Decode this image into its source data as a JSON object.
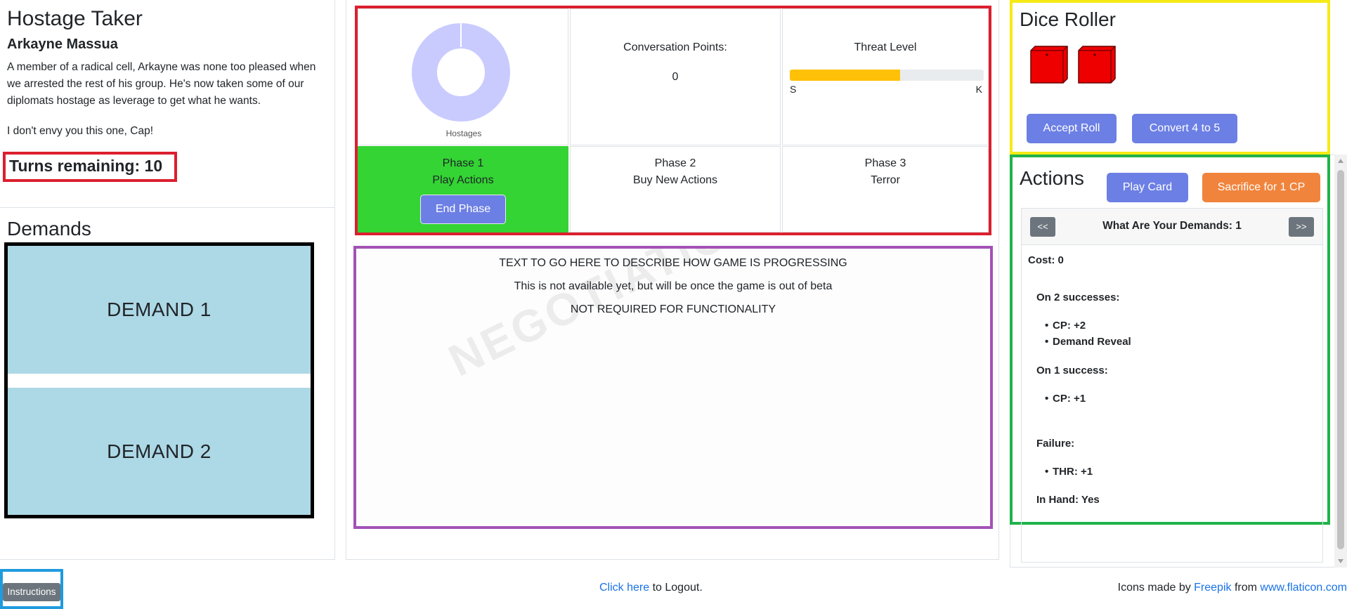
{
  "hostage_taker": {
    "title": "Hostage Taker",
    "name": "Arkayne Massua",
    "description": "A member of a radical cell, Arkayne was none too pleased when we arrested the rest of his group. He's now taken some of our diplomats hostage as leverage to get what he wants.",
    "quote": "I don't envy you this one, Cap!",
    "turns_remaining": "Turns remaining: 10"
  },
  "demands": {
    "title": "Demands",
    "items": [
      "DEMAND 1",
      "DEMAND 2"
    ]
  },
  "status": {
    "hostages_label": "Hostages",
    "conversation_points_label": "Conversation Points:",
    "conversation_points_value": "0",
    "threat_label": "Threat Level",
    "threat_fraction": 0.57,
    "threat_min_label": "S",
    "threat_max_label": "K"
  },
  "phases": [
    {
      "name": "Phase 1",
      "desc": "Play Actions",
      "active": true
    },
    {
      "name": "Phase 2",
      "desc": "Buy New Actions",
      "active": false
    },
    {
      "name": "Phase 3",
      "desc": "Terror",
      "active": false
    }
  ],
  "end_phase_label": "End Phase",
  "progress": {
    "watermark": "NEGOTIATION Beta",
    "lines": [
      "TEXT TO GO HERE TO DESCRIBE HOW GAME IS PROGRESSING",
      "This is not available yet, but will be once the game is out of beta",
      "NOT REQUIRED FOR FUNCTIONALITY"
    ]
  },
  "dice": {
    "title": "Dice Roller",
    "accept_label": "Accept Roll",
    "convert_label": "Convert 4 to 5",
    "color": "#ee0000"
  },
  "actions": {
    "title": "Actions",
    "play_label": "Play Card",
    "sacrifice_label": "Sacrifice for 1 CP",
    "prev_label": "<<",
    "next_label": ">>",
    "card_title": "What Are Your Demands: 1",
    "cost": "Cost: 0",
    "on_two_label": "On 2 successes:",
    "on_two_items": [
      "CP: +2",
      "Demand Reveal"
    ],
    "on_one_label": "On 1 success:",
    "on_one_items": [
      "CP: +1"
    ],
    "failure_label": "Failure:",
    "failure_items": [
      "THR: +1"
    ],
    "in_hand": "In Hand: Yes"
  },
  "footer": {
    "instructions_label": "Instructions",
    "logout_link": "Click here",
    "logout_rest": " to Logout.",
    "credit_prefix": "Icons made by ",
    "credit_freepik": "Freepik",
    "credit_from": " from ",
    "credit_site": "www.flaticon.com"
  },
  "colors": {
    "highlight_red": "#dc1f2e",
    "highlight_yellow": "#f5ea16",
    "highlight_green": "#1fb349",
    "highlight_purple": "#a352b5",
    "highlight_blue": "#1f9bde",
    "phase_active": "#33d433",
    "button_primary": "#6c7fe4",
    "button_orange": "#f0843c",
    "threat_fill": "#ffc107",
    "demand_card": "#add8e6",
    "donut": "#c9cbff"
  }
}
